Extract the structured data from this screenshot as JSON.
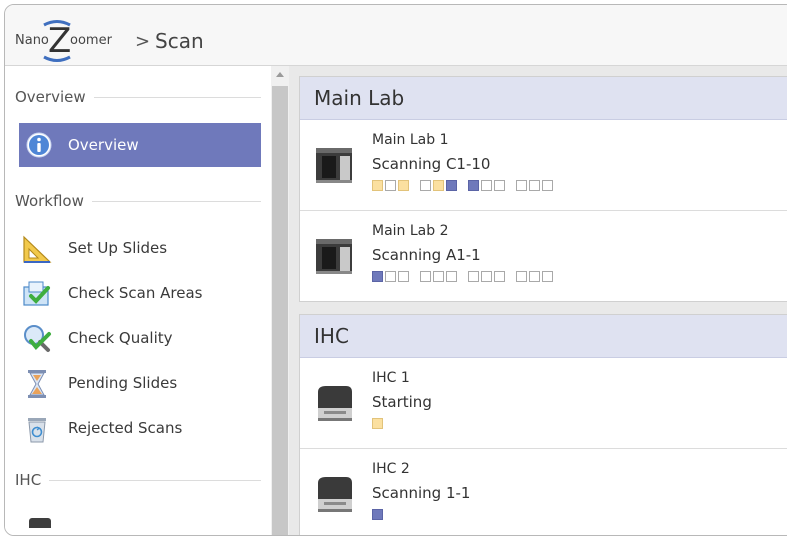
{
  "app": {
    "logo_text": "NanoZoomer",
    "breadcrumb_sep": ">",
    "page": "Scan"
  },
  "sidebar": {
    "sections": [
      {
        "title": "Overview"
      },
      {
        "title": "Workflow"
      },
      {
        "title": "IHC"
      }
    ],
    "overview_item": {
      "label": "Overview",
      "icon": "info-icon"
    },
    "workflow_items": [
      {
        "label": "Set Up Slides",
        "icon": "set-square-icon"
      },
      {
        "label": "Check Scan Areas",
        "icon": "check-areas-icon"
      },
      {
        "label": "Check Quality",
        "icon": "magnifier-check-icon"
      },
      {
        "label": "Pending Slides",
        "icon": "hourglass-icon"
      },
      {
        "label": "Rejected Scans",
        "icon": "recycle-bin-icon"
      }
    ]
  },
  "main": {
    "groups": [
      {
        "name": "Main Lab",
        "scanners": [
          {
            "name": "Main Lab 1",
            "status": "Scanning C1-10",
            "slots": [
              [
                "pending",
                "empty",
                "pending"
              ],
              [
                "empty",
                "pending",
                "done"
              ],
              [
                "done",
                "empty",
                "empty"
              ],
              [
                "empty",
                "empty",
                "empty"
              ]
            ]
          },
          {
            "name": "Main Lab 2",
            "status": "Scanning A1-1",
            "slots": [
              [
                "done",
                "empty",
                "empty"
              ],
              [
                "empty",
                "empty",
                "empty"
              ],
              [
                "empty",
                "empty",
                "empty"
              ],
              [
                "empty",
                "empty",
                "empty"
              ]
            ]
          }
        ]
      },
      {
        "name": "IHC",
        "scanners": [
          {
            "name": "IHC 1",
            "status": "Starting",
            "slots": [
              [
                "pending"
              ]
            ]
          },
          {
            "name": "IHC 2",
            "status": "Scanning 1-1",
            "slots": [
              [
                "done"
              ]
            ]
          }
        ]
      }
    ]
  },
  "colors": {
    "accent": "#6f79bb",
    "pending": "#fbe0a0",
    "group_header": "#dfe2f1"
  }
}
